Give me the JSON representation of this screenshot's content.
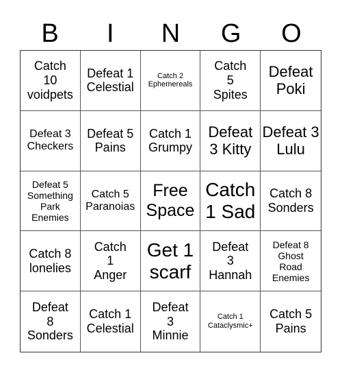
{
  "header": [
    "B",
    "I",
    "N",
    "G",
    "O"
  ],
  "cells": [
    "Catch 10 voidpets",
    "Defeat 1 Celestial",
    "Catch 2 Ephemereals",
    "Catch 5 Spites",
    "Defeat Poki",
    "Defeat 3 Checkers",
    "Defeat 5 Pains",
    "Catch 1 Grumpy",
    "Defeat 3 Kitty",
    "Defeat 3 Lulu",
    "Defeat 5 Something Park Enemies",
    "Catch 5 Paranoias",
    "Free Space",
    "Catch 1 Sad",
    "Catch 8 Sonders",
    "Catch 8 lonelies",
    "Catch 1 Anger",
    "Get 1 scarf",
    "Defeat 3 Hannah",
    "Defeat 8 Ghost Road Enemies",
    "Defeat 8 Sonders",
    "Catch 1 Celestial",
    "Defeat 3 Minnie",
    "Catch 1 Cataclysmic+",
    "Catch 5 Pains"
  ]
}
